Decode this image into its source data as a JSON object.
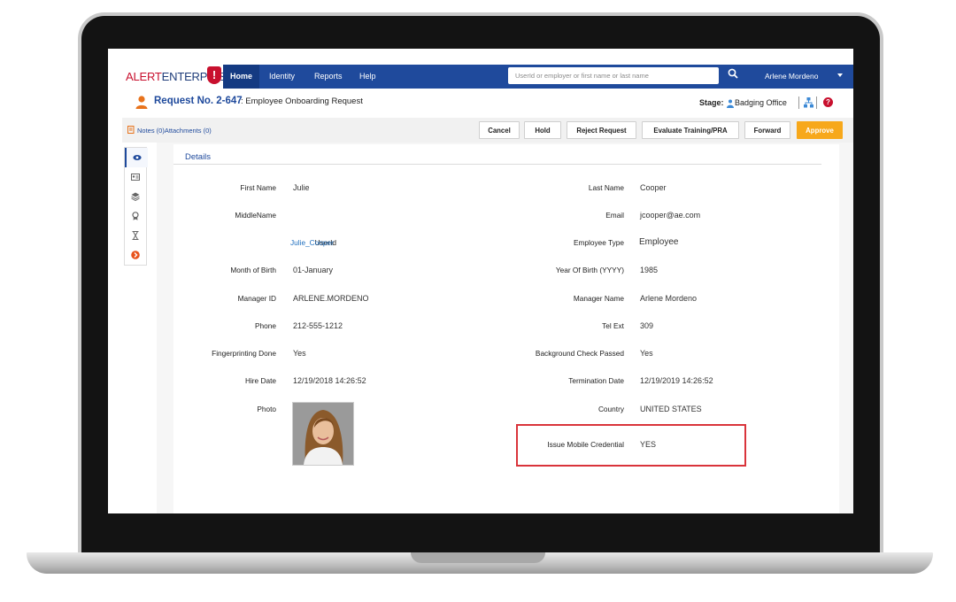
{
  "app": {
    "logo_part1": "ALERT",
    "logo_part2": "ENTERPRISE"
  },
  "nav": {
    "items": [
      "Home",
      "Identity",
      "Reports",
      "Help"
    ],
    "active": "Home",
    "search_placeholder": "UserId or employer or first name or last name",
    "user": "Arlene Mordeno"
  },
  "request": {
    "number": "Request No. 2-647",
    "separator": ":",
    "type": "Employee Onboarding Request",
    "stage_label": "Stage:",
    "stage_value": "Badging Office"
  },
  "actions": {
    "notes": "Notes (0)",
    "attachments": "Attachments (0)",
    "buttons": [
      "Cancel",
      "Hold",
      "Reject Request",
      "Evaluate Training/PRA",
      "Forward",
      "Approve"
    ]
  },
  "details": {
    "title": "Details",
    "left": [
      {
        "label": "First Name",
        "value": "Julie"
      },
      {
        "label": "MiddleName",
        "value": ""
      },
      {
        "label": "UserId",
        "value": "Julie_Cooper"
      },
      {
        "label": "Month of Birth",
        "value": "01-January"
      },
      {
        "label": "Manager ID",
        "value": "ARLENE.MORDENO"
      },
      {
        "label": "Phone",
        "value": "212-555-1212"
      },
      {
        "label": "Fingerprinting Done",
        "value": "Yes"
      },
      {
        "label": "Hire Date",
        "value": "12/19/2018 14:26:52"
      },
      {
        "label": "Photo",
        "value": ""
      }
    ],
    "right": [
      {
        "label": "Last Name",
        "value": "Cooper"
      },
      {
        "label": "Email",
        "value": "jcooper@ae.com"
      },
      {
        "label": "Employee Type",
        "value": "Employee"
      },
      {
        "label": "Year Of Birth (YYYY)",
        "value": "1985"
      },
      {
        "label": "Manager Name",
        "value": "Arlene Mordeno"
      },
      {
        "label": "Tel Ext",
        "value": "309"
      },
      {
        "label": "Background Check Passed",
        "value": "Yes"
      },
      {
        "label": "Termination Date",
        "value": "12/19/2019 14:26:52"
      },
      {
        "label": "Country",
        "value": "UNITED STATES"
      },
      {
        "label": "Issue Mobile Credential",
        "value": "YES"
      }
    ]
  },
  "colors": {
    "nav_blue": "#1f4a9c",
    "approve": "#f7a81b",
    "highlight": "#d9343b"
  }
}
